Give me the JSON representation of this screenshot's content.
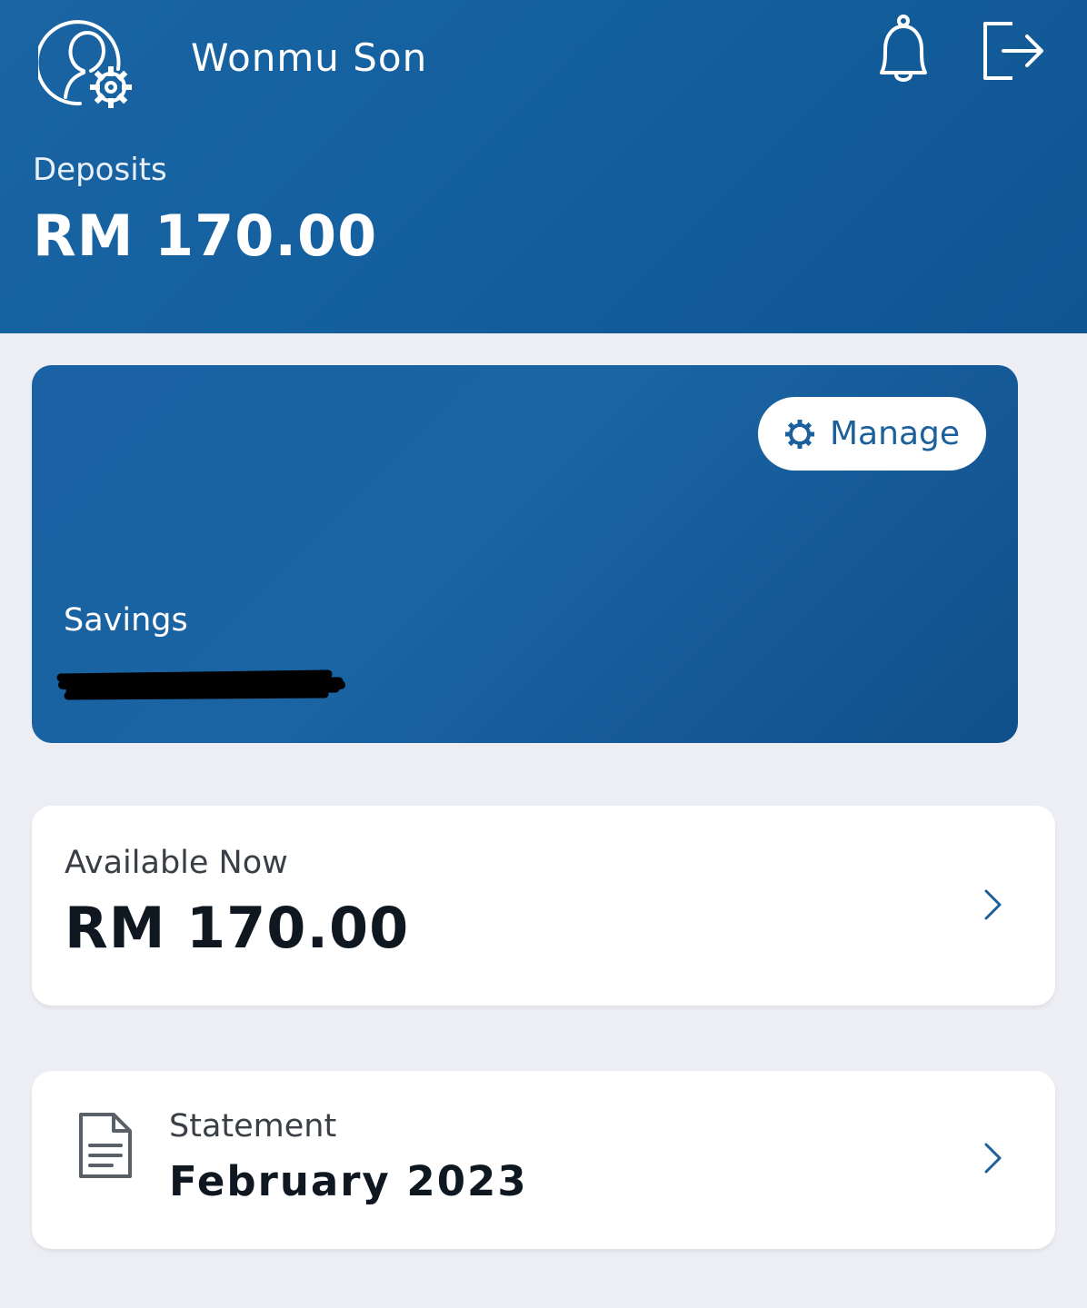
{
  "header": {
    "user_name": "Wonmu Son",
    "section_label": "Deposits",
    "total_amount": "RM 170.00",
    "icons": [
      "profile-settings-icon",
      "bell-icon",
      "logout-icon"
    ]
  },
  "account_card": {
    "manage_label": "Manage",
    "account_type": "Savings",
    "account_number": "redacted"
  },
  "available": {
    "label": "Available Now",
    "amount": "RM 170.00"
  },
  "statement": {
    "label": "Statement",
    "month": "February 2023"
  },
  "colors": {
    "brand_blue": "#1a64a3",
    "background": "#eceef4",
    "card": "#ffffff",
    "manage_text": "#1b5f9b"
  }
}
